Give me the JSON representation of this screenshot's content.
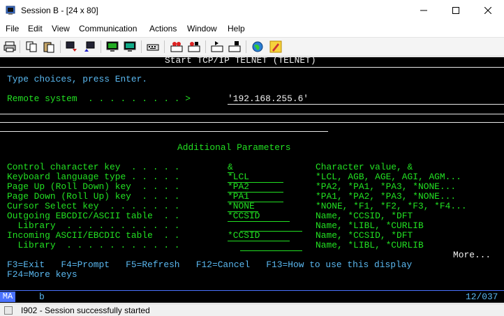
{
  "window": {
    "title": "Session B - [24 x 80]"
  },
  "menu": [
    "File",
    "Edit",
    "View",
    "Communication",
    "Actions",
    "Window",
    "Help"
  ],
  "terminal": {
    "header": "Start TCP/IP TELNET (TELNET)",
    "instruction": "Type choices, press Enter.",
    "remote_label": "Remote system  . . . . . . . . . >",
    "remote_value": "'192.168.255.6'",
    "section_title": "Additional Parameters",
    "params": [
      {
        "label": "Control character key  . . . . .",
        "value": "&",
        "help": "Character value, &"
      },
      {
        "label": "Keyboard language type . . . . .",
        "value": "*LCL",
        "help": "*LCL, AGB, AGE, AGI, AGM..."
      },
      {
        "label": "Page Up (Roll Down) key  . . . .",
        "value": "*PA2",
        "help": "*PA2, *PA1, *PA3, *NONE..."
      },
      {
        "label": "Page Down (Roll Up) key  . . . .",
        "value": "*PA1",
        "help": "*PA1, *PA2, *PA3, *NONE..."
      },
      {
        "label": "Cursor Select key  . . . . . . .",
        "value": "*NONE",
        "help": "*NONE, *F1, *F2, *F3, *F4..."
      },
      {
        "label": "Outgoing EBCDIC/ASCII table  . .",
        "value": "*CCSID",
        "help": "Name, *CCSID, *DFT"
      },
      {
        "label": "  Library  . . . . . . . . . . .",
        "value": "",
        "help": "Name, *LIBL, *CURLIB"
      },
      {
        "label": "Incoming ASCII/EBCDIC table  . .",
        "value": "*CCSID",
        "help": "Name, *CCSID, *DFT"
      },
      {
        "label": "  Library  . . . . . . . . . . .",
        "value": "",
        "help": "Name, *LIBL, *CURLIB"
      }
    ],
    "more": "More...",
    "fkeys_1": "F3=Exit   F4=Prompt   F5=Refresh   F12=Cancel   F13=How to use this display",
    "fkeys_2": "F24=More keys"
  },
  "oia": {
    "mode": "MA",
    "indicator": "b",
    "cursor_pos": "12/037"
  },
  "status": {
    "text": "I902 - Session successfully started"
  }
}
